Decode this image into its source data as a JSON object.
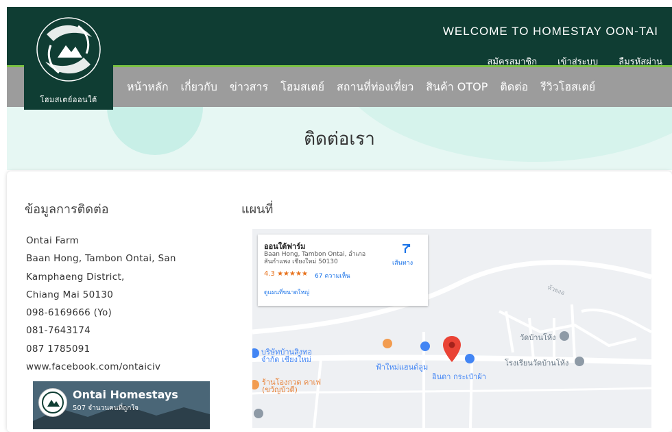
{
  "site": {
    "logo_text": "โฮมสเตย์ออนใต้",
    "welcome": "WELCOME TO HOMESTAY OON-TAI"
  },
  "top_links": [
    "สมัครสมาชิก",
    "เข้าสู่ระบบ",
    "ลืมรหัสผ่าน"
  ],
  "nav": [
    "หน้าหลัก",
    "เกี่ยวกับ",
    "ข่าวสาร",
    "โฮมสเตย์",
    "สถานที่ท่องเที่ยว",
    "สินค้า OTOP",
    "ติดต่อ",
    "รีวิวโฮสเตย์"
  ],
  "page_title": "ติดต่อเรา",
  "contact": {
    "heading": "ข้อมูลการติดต่อ",
    "lines": [
      "Ontai Farm",
      "Baan Hong, Tambon Ontai, San",
      "Kamphaeng District,",
      "Chiang Mai 50130",
      "098-6169666 (Yo)",
      "081-7643174",
      "087 1785091",
      "www.facebook.com/ontaiciv"
    ]
  },
  "facebook": {
    "name": "Ontai Homestays",
    "likes": "507 จำนวนคนที่ถูกใจ"
  },
  "map": {
    "heading": "แผนที่",
    "place_name": "ออนใต้ฟาร์ม",
    "address": "Baan Hong, Tambon Ontai, อำเภอ สันกำแพง เชียงใหม่ 50130",
    "rating": "4.3 ★★★★★",
    "reviews": "67 ความเห็น",
    "larger_map": "ดูแผนที่ขนาดใหญ่",
    "directions": "เส้นทาง",
    "pois": {
      "wat": "วัดบ้านโห้ง",
      "school": "โรงเรียนวัดบ้านโห้ง",
      "company": "บริษัทบ้านสิงทอ จำกัด เชียงใหม่",
      "cafe": "ร้านโองกวด คาเฟ (ขวัญบ้วดี)",
      "shop": "ฟ้าใหม่แฮนด์ลูม",
      "bag": "อินดา กระเป๋าผ้า",
      "road": "ห้วยงอ"
    },
    "colors": {
      "accent": "#1a73e8",
      "pin": "#ea4335",
      "poi_blue": "#4285f4",
      "poi_orange": "#f29c50"
    }
  },
  "colors": {
    "header": "#0f3d33",
    "nav": "#9c9c9c",
    "accent_green": "#7bc243",
    "hero": "#e6f7f3"
  }
}
